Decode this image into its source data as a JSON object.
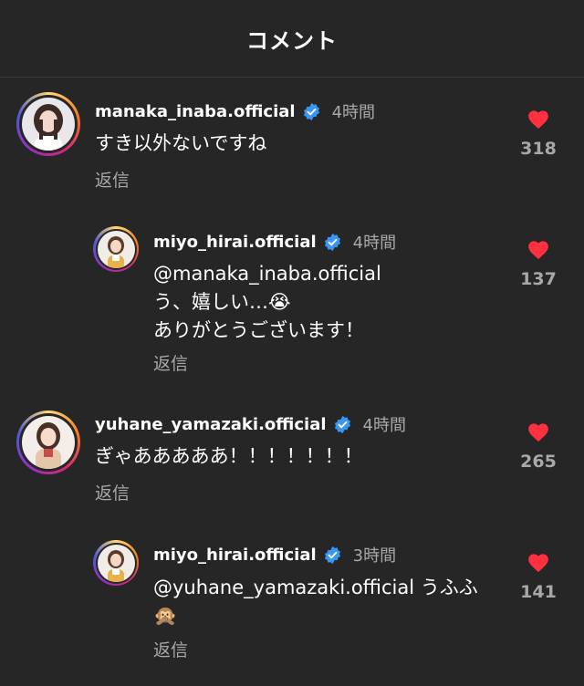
{
  "header": {
    "title": "コメント"
  },
  "colors": {
    "background": "#262626",
    "heart": "#ff3040",
    "verified": "#3897f0",
    "muted": "#a8a8a8"
  },
  "comments": [
    {
      "username": "manaka_inaba.official",
      "verified": true,
      "time": "4時間",
      "text_lines": [
        "すき以外ないですね"
      ],
      "reply_label": "返信",
      "likes": "318"
    },
    {
      "username": "miyo_hirai.official",
      "verified": true,
      "time": "4時間",
      "text_lines": [
        "@manaka_inaba.official",
        "う、嬉しい…😭",
        "ありがとうございます！"
      ],
      "reply_label": "返信",
      "likes": "137"
    },
    {
      "username": "yuhane_yamazaki.official",
      "verified": true,
      "time": "4時間",
      "text_lines": [
        "ぎゃあああああ！！！！！！！"
      ],
      "reply_label": "返信",
      "likes": "265"
    },
    {
      "username": "miyo_hirai.official",
      "verified": true,
      "time": "3時間",
      "text_lines": [
        "@yuhane_yamazaki.official うふふ",
        "🙊"
      ],
      "reply_label": "返信",
      "likes": "141"
    }
  ]
}
